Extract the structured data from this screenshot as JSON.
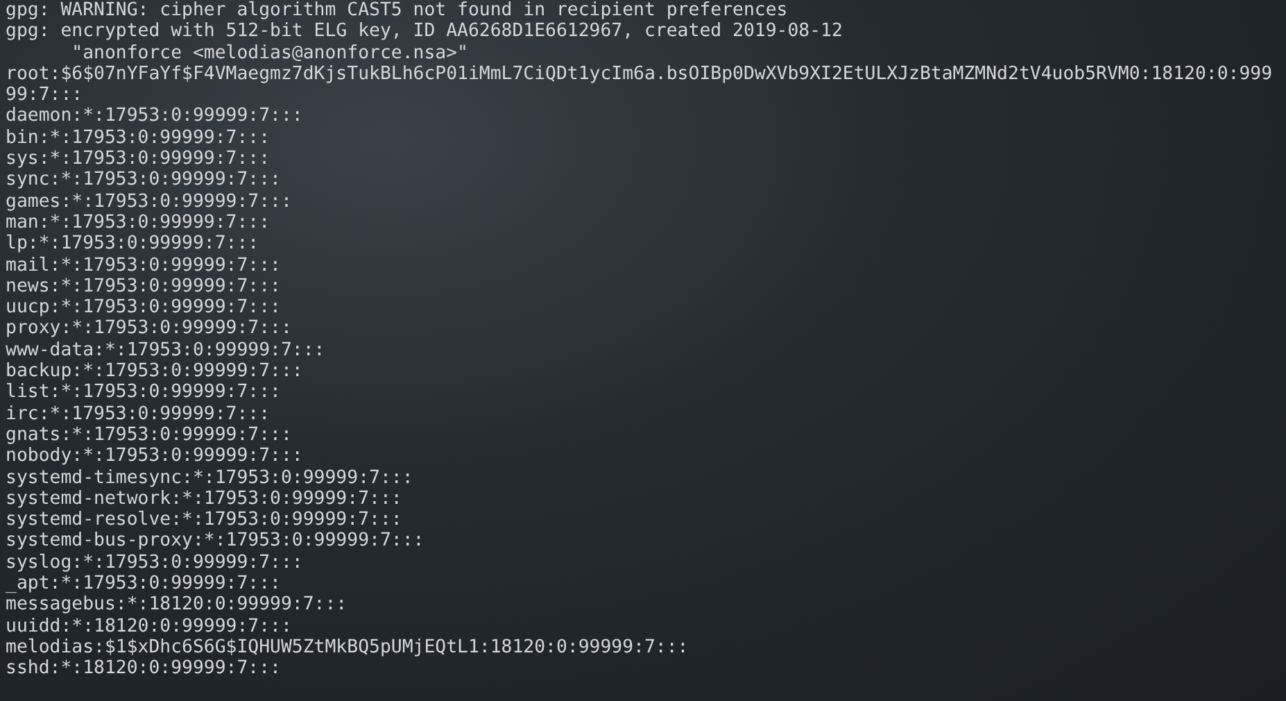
{
  "terminal": {
    "lines": [
      "gpg: WARNING: cipher algorithm CAST5 not found in recipient preferences",
      "gpg: encrypted with 512-bit ELG key, ID AA6268D1E6612967, created 2019-08-12",
      "      \"anonforce <melodias@anonforce.nsa>\"",
      "root:$6$07nYFaYf$F4VMaegmz7dKjsTukBLh6cP01iMmL7CiQDt1ycIm6a.bsOIBp0DwXVb9XI2EtULXJzBtaMZMNd2tV4uob5RVM0:18120:0:99999:7:::",
      "daemon:*:17953:0:99999:7:::",
      "bin:*:17953:0:99999:7:::",
      "sys:*:17953:0:99999:7:::",
      "sync:*:17953:0:99999:7:::",
      "games:*:17953:0:99999:7:::",
      "man:*:17953:0:99999:7:::",
      "lp:*:17953:0:99999:7:::",
      "mail:*:17953:0:99999:7:::",
      "news:*:17953:0:99999:7:::",
      "uucp:*:17953:0:99999:7:::",
      "proxy:*:17953:0:99999:7:::",
      "www-data:*:17953:0:99999:7:::",
      "backup:*:17953:0:99999:7:::",
      "list:*:17953:0:99999:7:::",
      "irc:*:17953:0:99999:7:::",
      "gnats:*:17953:0:99999:7:::",
      "nobody:*:17953:0:99999:7:::",
      "systemd-timesync:*:17953:0:99999:7:::",
      "systemd-network:*:17953:0:99999:7:::",
      "systemd-resolve:*:17953:0:99999:7:::",
      "systemd-bus-proxy:*:17953:0:99999:7:::",
      "syslog:*:17953:0:99999:7:::",
      "_apt:*:17953:0:99999:7:::",
      "messagebus:*:18120:0:99999:7:::",
      "uuidd:*:18120:0:99999:7:::",
      "melodias:$1$xDhc6S6G$IQHUW5ZtMkBQ5pUMjEQtL1:18120:0:99999:7:::",
      "sshd:*:18120:0:99999:7:::"
    ]
  }
}
